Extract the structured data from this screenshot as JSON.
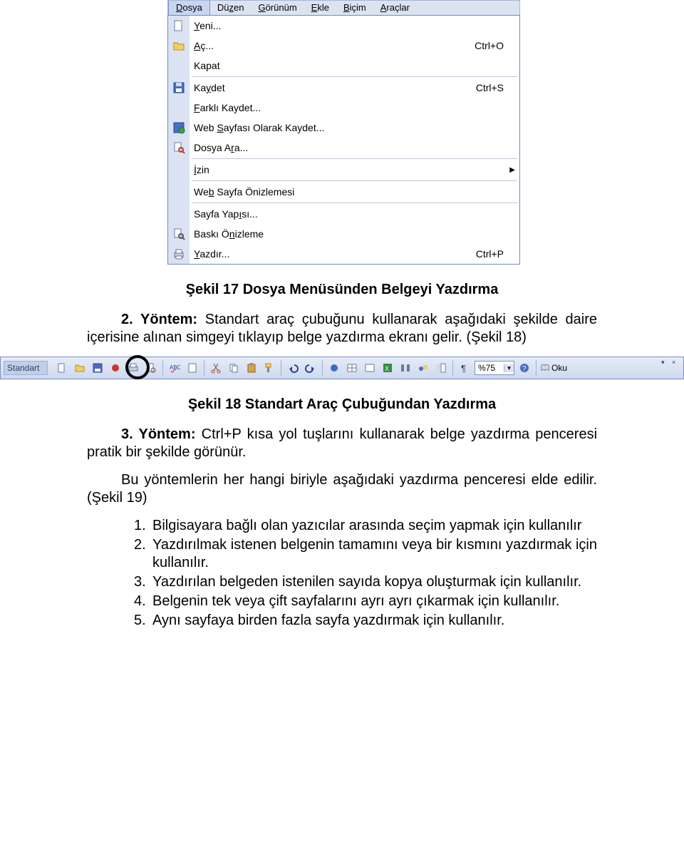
{
  "menubar": {
    "items": [
      {
        "label": "Dosya",
        "accel": "D",
        "active": true
      },
      {
        "label": "Düzen",
        "accel": "z",
        "active": false
      },
      {
        "label": "Görünüm",
        "accel": "G",
        "active": false
      },
      {
        "label": "Ekle",
        "accel": "E",
        "active": false
      },
      {
        "label": "Biçim",
        "accel": "B",
        "active": false
      },
      {
        "label": "Araçlar",
        "accel": "A",
        "active": false
      }
    ]
  },
  "dropdown": {
    "items": [
      {
        "icon": "new-doc-icon",
        "label": "Yeni...",
        "shortcut": ""
      },
      {
        "icon": "open-icon",
        "label": "Aç...",
        "shortcut": "Ctrl+O"
      },
      {
        "icon": "",
        "label": "Kapat",
        "shortcut": ""
      },
      {
        "sep": true
      },
      {
        "icon": "save-icon",
        "label": "Kaydet",
        "shortcut": "Ctrl+S"
      },
      {
        "icon": "",
        "label": "Farklı Kaydet...",
        "shortcut": ""
      },
      {
        "icon": "save-web-icon",
        "label": "Web Sayfası Olarak Kaydet...",
        "shortcut": ""
      },
      {
        "icon": "file-search-icon",
        "label": "Dosya Ara...",
        "shortcut": ""
      },
      {
        "sep": true
      },
      {
        "icon": "",
        "label": "İzin",
        "shortcut": "",
        "submenu": true
      },
      {
        "sep": true
      },
      {
        "icon": "",
        "label": "Web Sayfa Önizlemesi",
        "shortcut": ""
      },
      {
        "sep": true
      },
      {
        "icon": "",
        "label": "Sayfa Yapısı...",
        "shortcut": ""
      },
      {
        "icon": "print-preview-icon",
        "label": "Baskı Önizleme",
        "shortcut": ""
      },
      {
        "icon": "print-icon",
        "label": "Yazdır...",
        "shortcut": "Ctrl+P"
      }
    ]
  },
  "captions": {
    "c17": "Şekil 17 Dosya Menüsünden Belgeyi Yazdırma",
    "c18": "Şekil 18 Standart Araç Çubuğundan Yazdırma"
  },
  "paragraphs": {
    "p1a": "2. Yöntem: ",
    "p1b": "Standart araç çubuğunu kullanarak aşağıdaki şekilde daire içerisine alınan simgeyi tıklayıp belge yazdırma ekranı gelir. (Şekil 18)",
    "p2a": "3. Yöntem: ",
    "p2b": "Ctrl+P kısa yol tuşlarını kullanarak belge yazdırma penceresi pratik bir şekilde görünür.",
    "p3": "Bu yöntemlerin her hangi biriyle aşağıdaki yazdırma penceresi elde edilir. (Şekil 19)"
  },
  "toolbar": {
    "title": "Standart",
    "zoom": "%75",
    "read": "Oku"
  },
  "list": {
    "items": [
      {
        "n": "1.",
        "t": "Bilgisayara bağlı olan yazıcılar arasında seçim yapmak için kullanılır"
      },
      {
        "n": "2.",
        "t": "Yazdırılmak istenen belgenin tamamını veya bir kısmını yazdırmak için kullanılır."
      },
      {
        "n": "3.",
        "t": "Yazdırılan belgeden istenilen sayıda kopya oluşturmak için kullanılır."
      },
      {
        "n": "4.",
        "t": "Belgenin tek veya çift sayfalarını ayrı ayrı çıkarmak için kullanılır."
      },
      {
        "n": "5.",
        "t": "Aynı sayfaya birden fazla sayfa yazdırmak için kullanılır."
      }
    ]
  }
}
